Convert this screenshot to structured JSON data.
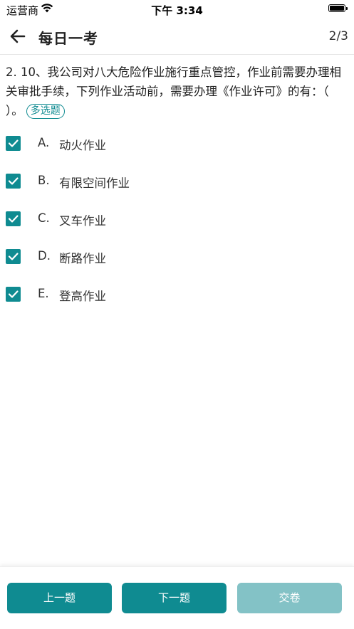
{
  "status_bar": {
    "carrier": "运营商",
    "time": "下午 3:34"
  },
  "nav": {
    "title": "每日一考",
    "progress": "2/3"
  },
  "question": {
    "text": "2. 10、我公司对八大危险作业施行重点管控，作业前需要办理相关审批手续，下列作业活动前，需要办理《作业许可》的有：（ ）。",
    "type_badge": "多选题"
  },
  "options": [
    {
      "letter": "A.",
      "text": "动火作业",
      "checked": true
    },
    {
      "letter": "B.",
      "text": "有限空间作业",
      "checked": true
    },
    {
      "letter": "C.",
      "text": "叉车作业",
      "checked": true
    },
    {
      "letter": "D.",
      "text": "断路作业",
      "checked": true
    },
    {
      "letter": "E.",
      "text": "登高作业",
      "checked": true
    }
  ],
  "buttons": {
    "prev": "上一题",
    "next": "下一题",
    "submit": "交卷"
  },
  "colors": {
    "accent": "#0f8b91",
    "accent_disabled": "#83c2c6"
  }
}
